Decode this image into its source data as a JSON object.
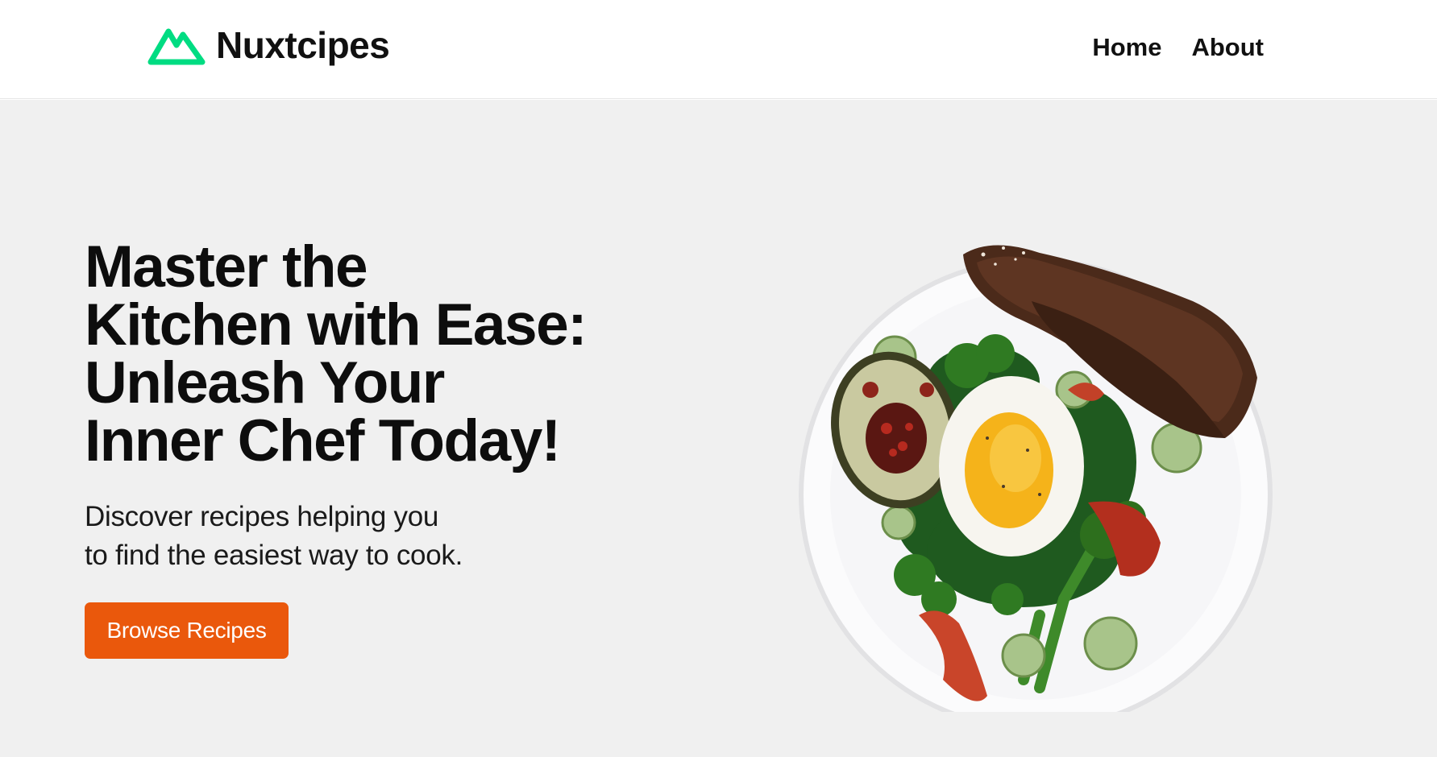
{
  "header": {
    "brand_name": "Nuxtcipes",
    "logo_icon": "nuxt-mountain-logo-icon",
    "brand_color": "#00dc82",
    "nav": [
      {
        "label": "Home"
      },
      {
        "label": "About"
      }
    ]
  },
  "hero": {
    "title": "Master the\nKitchen with Ease:\nUnleash Your\nInner Chef Today!",
    "subtitle": "Discover recipes helping you\nto find the easiest way to cook.",
    "cta_label": "Browse Recipes",
    "cta_color": "#ea580c",
    "background_color": "#f0f0f0",
    "image_icon": "plate-with-egg-avocado-broccoli-and-bread-image"
  }
}
